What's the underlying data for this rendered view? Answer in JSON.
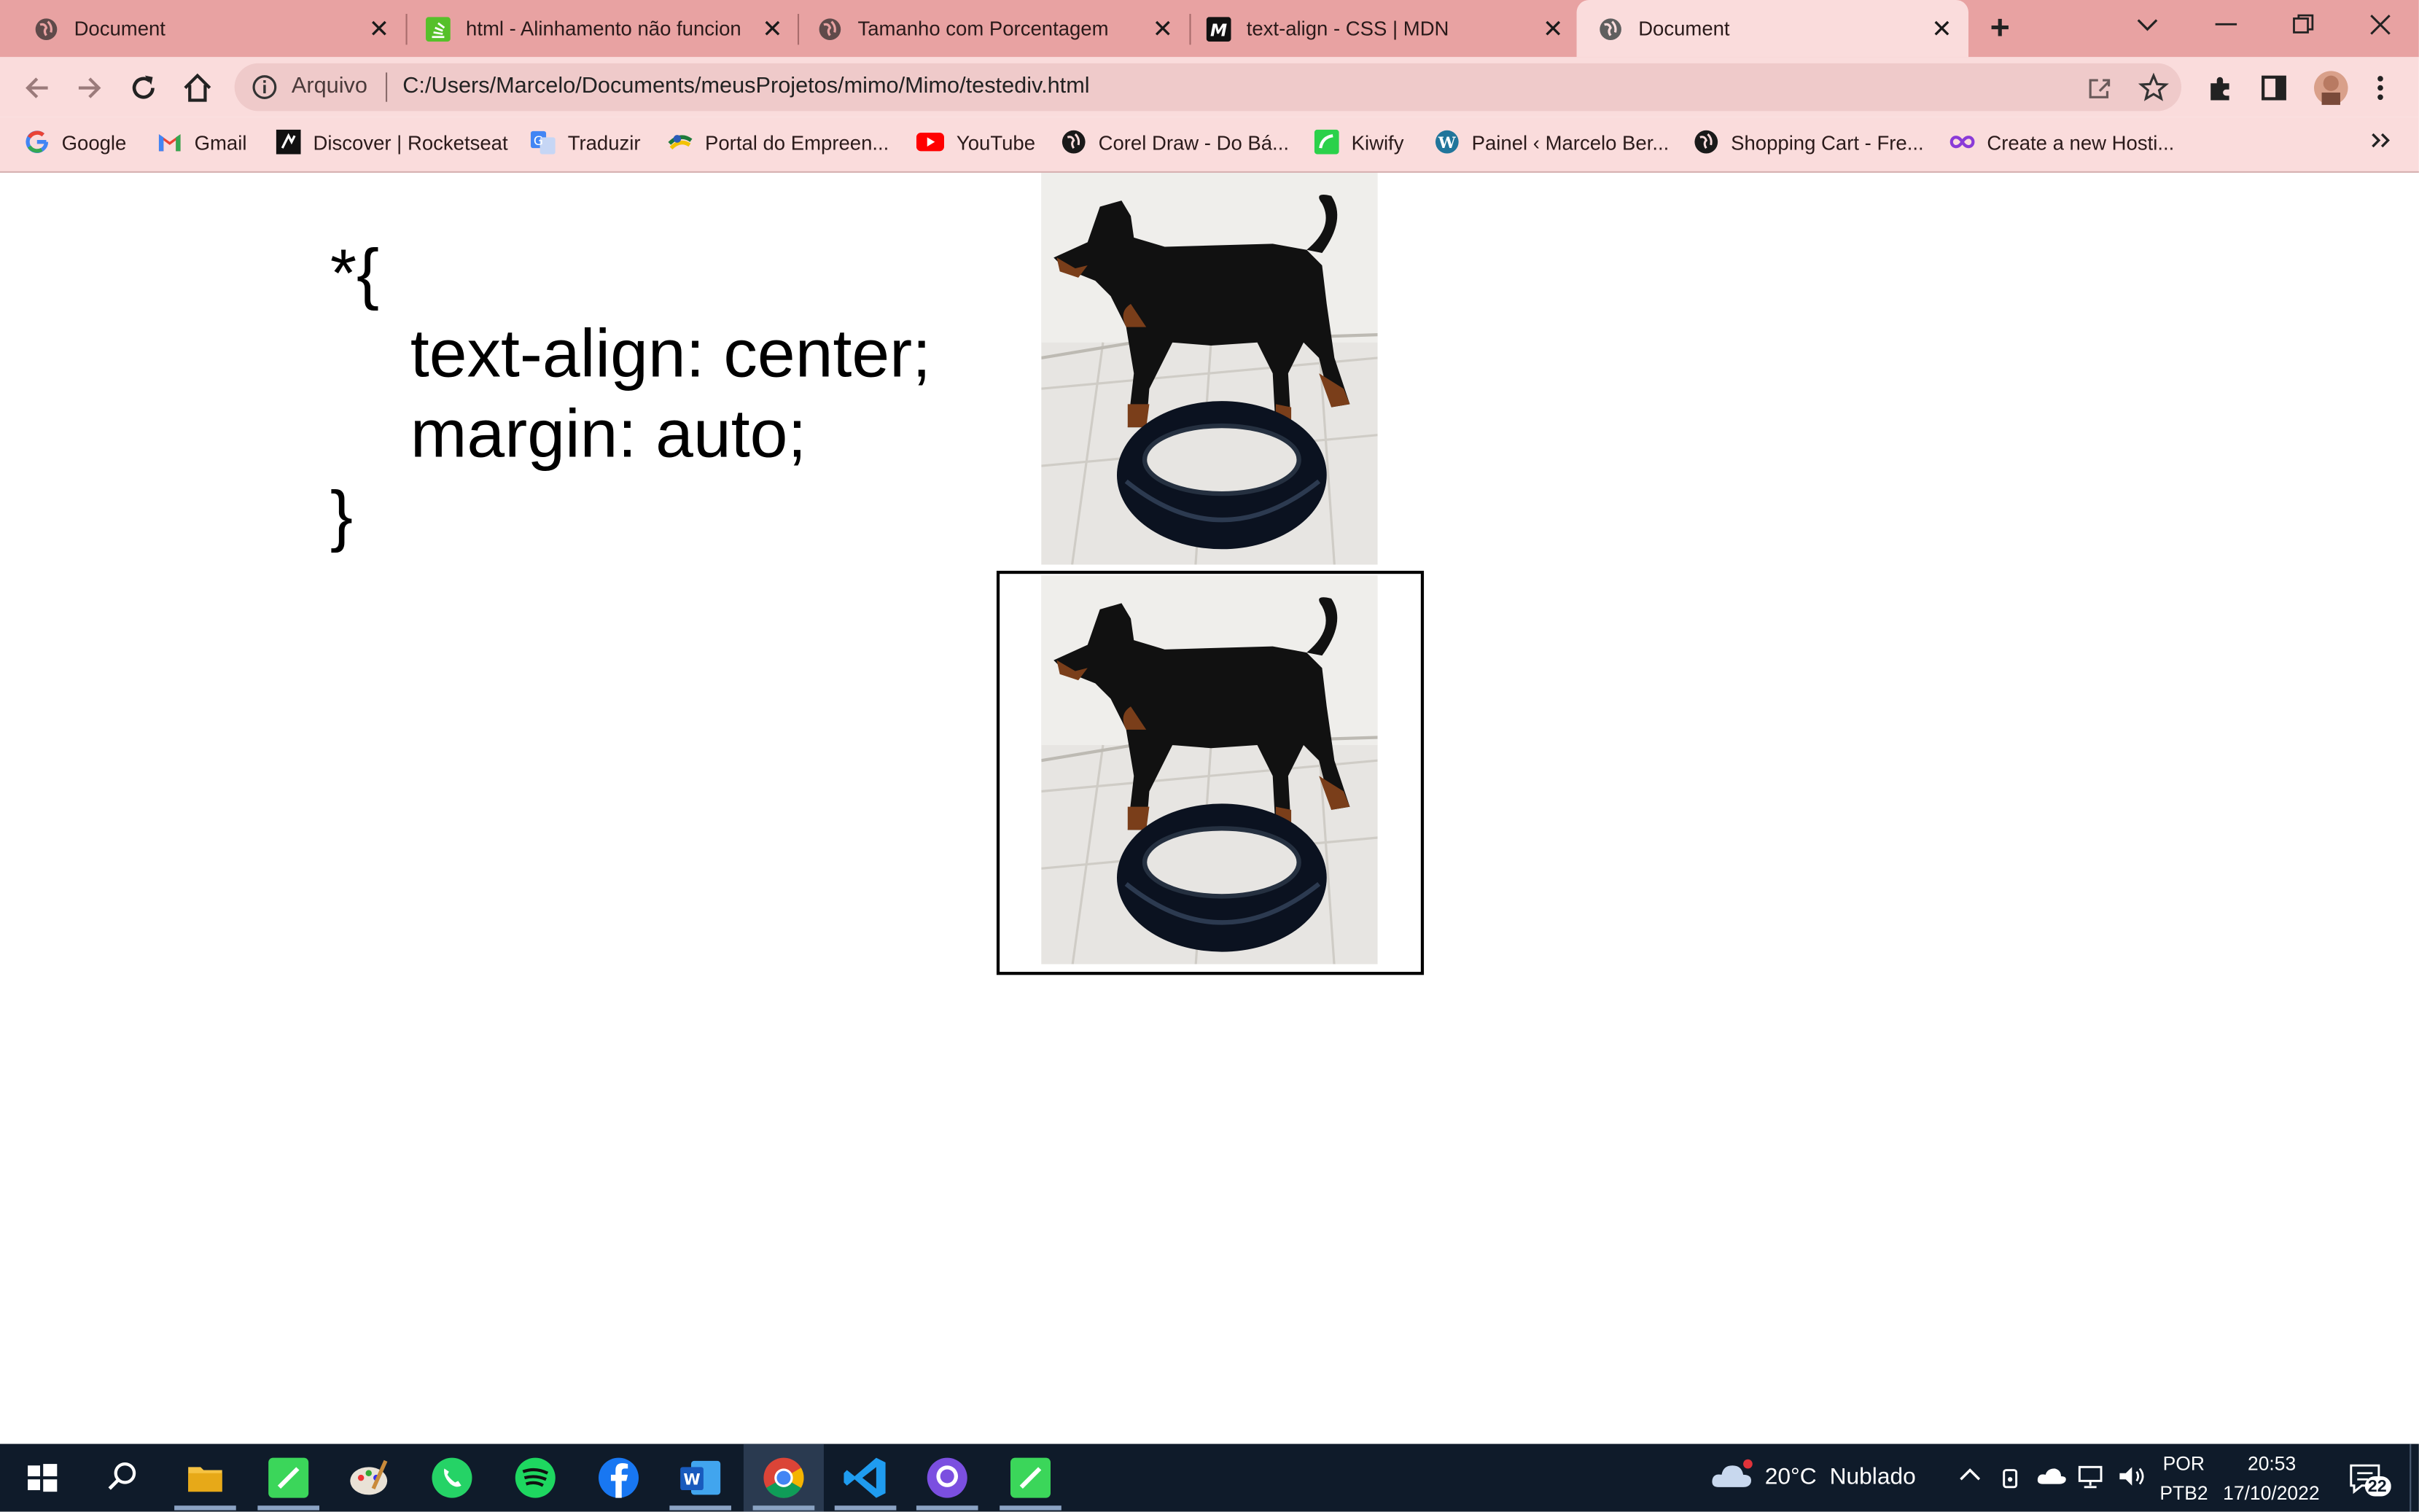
{
  "tabs": [
    {
      "title": "Document",
      "active": false,
      "favicon": "globe-icon"
    },
    {
      "title": "html - Alinhamento não funcion",
      "active": false,
      "favicon": "stackoverflow-icon"
    },
    {
      "title": "Tamanho com Porcentagem",
      "active": false,
      "favicon": "globe-icon"
    },
    {
      "title": "text-align - CSS | MDN",
      "active": false,
      "favicon": "mdn-icon"
    },
    {
      "title": "Document",
      "active": true,
      "favicon": "globe-icon"
    }
  ],
  "toolbar": {
    "site_info_label": "Arquivo",
    "url": "C:/Users/Marcelo/Documents/meusProjetos/mimo/Mimo/testediv.html"
  },
  "bookmarks": [
    {
      "label": "Google",
      "icon": "google-icon"
    },
    {
      "label": "Gmail",
      "icon": "gmail-icon"
    },
    {
      "label": "Discover | Rocketseat",
      "icon": "rocketseat-icon"
    },
    {
      "label": "Traduzir",
      "icon": "translate-icon"
    },
    {
      "label": "Portal do Empreen...",
      "icon": "portal-icon"
    },
    {
      "label": "YouTube",
      "icon": "youtube-icon"
    },
    {
      "label": "Corel Draw - Do Bá...",
      "icon": "globe-icon"
    },
    {
      "label": "Kiwify",
      "icon": "kiwify-icon"
    },
    {
      "label": "Painel ‹ Marcelo Ber...",
      "icon": "wordpress-icon"
    },
    {
      "label": "Shopping Cart - Fre...",
      "icon": "globe-icon"
    },
    {
      "label": "Create a new Hosti...",
      "icon": "infinity-icon"
    }
  ],
  "page": {
    "code_lines": [
      "*{",
      "text-align: center;",
      "margin: auto;",
      "}"
    ]
  },
  "taskbar": {
    "weather_temp": "20°C",
    "weather_text": "Nublado",
    "lang": "POR",
    "layout": "PTB2",
    "time": "20:53",
    "date": "17/10/2022",
    "notifications": "22"
  },
  "colors": {
    "tabstrip": "#e8a2a2",
    "toolbar": "#fadcdc",
    "taskbar": "#0f1b2a"
  }
}
